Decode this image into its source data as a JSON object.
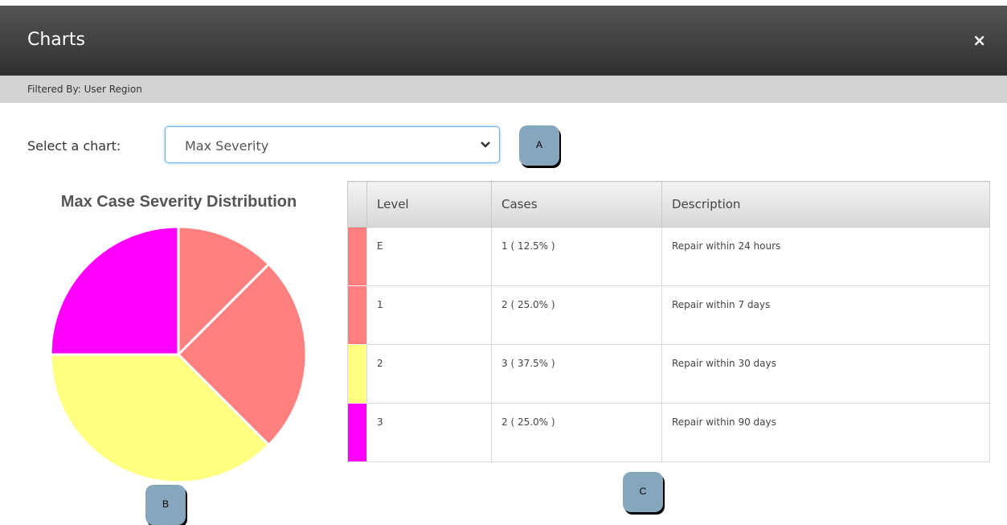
{
  "window": {
    "title": "Charts",
    "close_label": "×"
  },
  "filter": {
    "text": "Filtered By: User Region"
  },
  "selector": {
    "label": "Select a chart:",
    "value": "Max Severity"
  },
  "markers": {
    "a": "A",
    "b": "B",
    "c": "C"
  },
  "chart_data": {
    "type": "pie",
    "title": "Max Case Severity Distribution",
    "categories": [
      "E",
      "1",
      "2",
      "3"
    ],
    "values": [
      1,
      2,
      3,
      2
    ],
    "colors": [
      "#ff807f",
      "#ff807f",
      "#ffff80",
      "#ff00ff"
    ]
  },
  "table": {
    "columns": [
      "Level",
      "Cases",
      "Description"
    ],
    "rows": [
      {
        "level": "E",
        "cases": "1 ( 12.5% )",
        "description": "Repair within 24 hours",
        "color": "#ff807f"
      },
      {
        "level": "1",
        "cases": "2 ( 25.0% )",
        "description": "Repair within 7 days",
        "color": "#ff807f"
      },
      {
        "level": "2",
        "cases": "3 ( 37.5% )",
        "description": "Repair within 30 days",
        "color": "#ffff80"
      },
      {
        "level": "3",
        "cases": "2 ( 25.0% )",
        "description": "Repair within 90 days",
        "color": "#ff00ff"
      }
    ]
  }
}
